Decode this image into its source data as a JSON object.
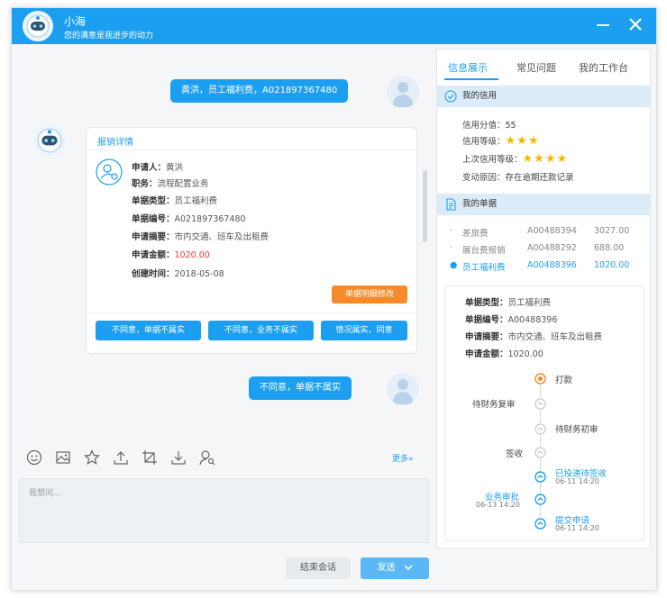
{
  "title": {
    "name": "小海",
    "subtitle": "您的满意是我进步的动力"
  },
  "chat": {
    "user_msg_1": "黄洪，员工福利费，A021897367480",
    "card": {
      "title": "报销详情",
      "rows": [
        {
          "label": "申请人：",
          "value": "黄洪"
        },
        {
          "label": "职务：",
          "value": "流程配置业务"
        },
        {
          "label": "单据类型：",
          "value": "员工福利费"
        },
        {
          "label": "单据编号：",
          "value": "A021897367480"
        },
        {
          "label": "申请摘要：",
          "value": "市内交通、班车及出租费"
        },
        {
          "label": "申请金额：",
          "value": "1020.00"
        },
        {
          "label": "创建时间：",
          "value": "2018-05-08"
        }
      ],
      "modify_button": "单据明细修改",
      "actions": [
        "不同意，单据不属实",
        "不同意，业务不属实",
        "情况属实，同意"
      ]
    },
    "user_msg_2": "不同意，单据不属实"
  },
  "toolbar": {
    "more": "更多»"
  },
  "input": {
    "placeholder": "我想问..."
  },
  "footer": {
    "end": "结束会话",
    "send": "发送"
  },
  "right": {
    "tabs": [
      "信息展示",
      "常见问题",
      "我的工作台"
    ],
    "credit": {
      "header": "我的信用",
      "score_label": "信用分值：",
      "score": "55",
      "level_label": "信用等级：",
      "level_stars": "★★★",
      "last_label": "上次信用等级：",
      "last_stars": "★★★★",
      "reason_label": "变动原因：",
      "reason": "存在逾期还款记录"
    },
    "docs": {
      "header": "我的单据",
      "list": [
        {
          "type": "差旅费",
          "id": "A00488394",
          "amount": "3027.00"
        },
        {
          "type": "展台费报销",
          "id": "A00488292",
          "amount": "688.00"
        },
        {
          "type": "员工福利费",
          "id": "A00488396",
          "amount": "1020.00"
        }
      ]
    },
    "detail": {
      "rows": [
        {
          "label": "单据类型：",
          "value": "员工福利费"
        },
        {
          "label": "单据编号：",
          "value": "A00488396"
        },
        {
          "label": "申请摘要：",
          "value": "市内交通、班车及出租费"
        },
        {
          "label": "申请金额：",
          "value": "1020.00"
        }
      ],
      "timeline": [
        {
          "label": "打款",
          "time": ""
        },
        {
          "label": "待财务复审",
          "time": ""
        },
        {
          "label": "待财务初审",
          "time": ""
        },
        {
          "label": "签收",
          "time": ""
        },
        {
          "label": "已投递待签收",
          "time": "06-11  14:20"
        },
        {
          "label": "业务审批",
          "time": "06-13  14:20"
        },
        {
          "label": "提交申请",
          "time": "06-11  14:20"
        }
      ]
    }
  },
  "colors": {
    "accent": "#1c9ff0",
    "orange": "#f58b2a",
    "red": "#ee3b3b",
    "star": "#f5b800"
  }
}
